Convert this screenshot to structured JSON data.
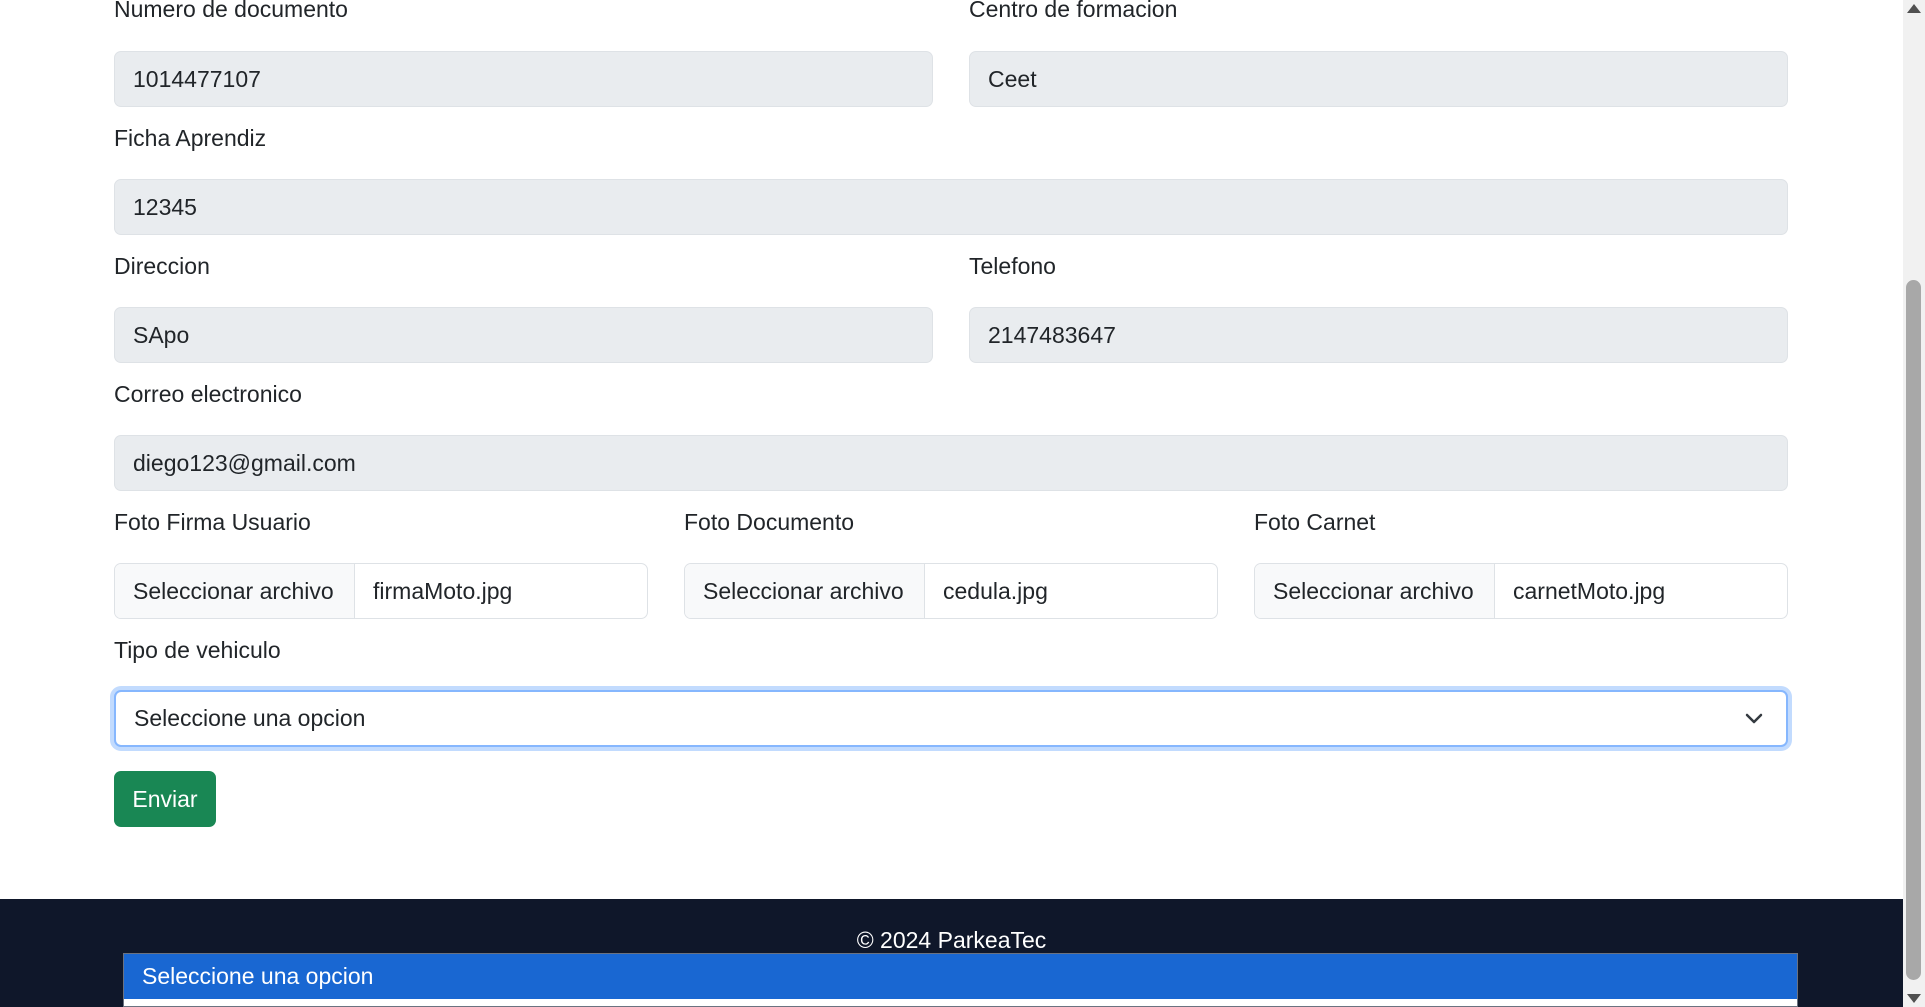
{
  "form": {
    "numero_documento": {
      "label": "Numero de documento",
      "value": "1014477107"
    },
    "centro_formacion": {
      "label": "Centro de formacion",
      "value": "Ceet"
    },
    "ficha_aprendiz": {
      "label": "Ficha Aprendiz",
      "value": "12345"
    },
    "direccion": {
      "label": "Direccion",
      "value": "SApo"
    },
    "telefono": {
      "label": "Telefono",
      "value": "2147483647"
    },
    "correo": {
      "label": "Correo electronico",
      "value": "diego123@gmail.com"
    },
    "foto_firma": {
      "label": "Foto Firma Usuario",
      "button": "Seleccionar archivo",
      "file": "firmaMoto.jpg"
    },
    "foto_documento": {
      "label": "Foto Documento",
      "button": "Seleccionar archivo",
      "file": "cedula.jpg"
    },
    "foto_carnet": {
      "label": "Foto Carnet",
      "button": "Seleccionar archivo",
      "file": "carnetMoto.jpg"
    },
    "tipo_vehiculo": {
      "label": "Tipo de vehiculo",
      "selected": "Seleccione una opcion"
    },
    "submit_label": "Enviar"
  },
  "footer": {
    "copyright": "© 2024 ParkeaTec"
  },
  "dropdown": {
    "options": [
      "Seleccione una opcion"
    ]
  },
  "colors": {
    "submit": "#198754",
    "footer_bg": "#0f172a",
    "option_highlight": "#1967d2",
    "readonly_input_bg": "#e9ecef"
  }
}
